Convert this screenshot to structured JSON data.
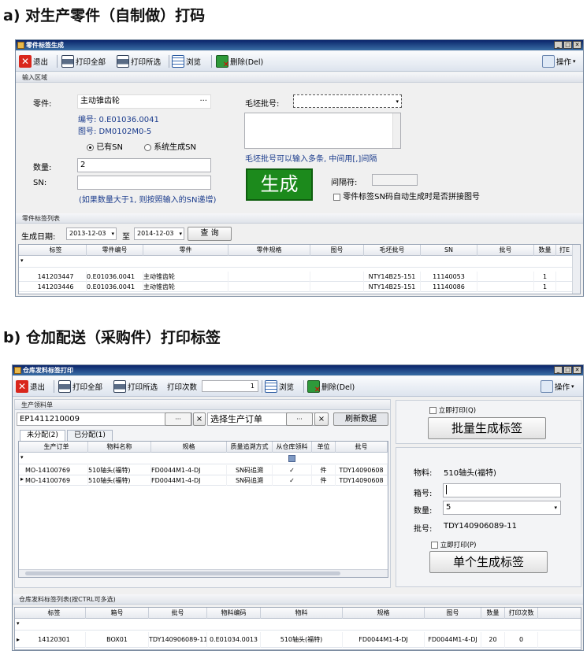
{
  "caption_a": "a) 对生产零件（自制做）打码",
  "caption_b": "b) 仓加配送（采购件）打印标签",
  "win1": {
    "title": "零件标签生成",
    "toolbar": {
      "exit": "退出",
      "print_all": "打印全部",
      "print_selected": "打印所选",
      "browse": "浏览",
      "delete": "删除(Del)",
      "operate": "操作"
    },
    "input_section": "输入区域",
    "part_label": "零件:",
    "part_value": "主动锥齿轮",
    "part_btn": "···",
    "code_line": "编号: 0.E01036.0041",
    "drawing_line": "图号: DM0102M0-5",
    "radio_has_sn": "已有SN",
    "radio_system_sn": "系统生成SN",
    "blank_label": "毛坯批号:",
    "blank_hint": "毛坯批号可以输入多条, 中间用[,]间隔",
    "qty_label": "数量:",
    "qty_value": "2",
    "sn_label": "SN:",
    "sn_hint": "(如果数量大于1, 则按照输入的SN递增)",
    "generate": "生成",
    "separator_label": "间隔符:",
    "concat_check": "零件标签SN码自动生成时是否拼接图号",
    "list_section": "零件标签列表",
    "date_label": "生成日期:",
    "date_from": "2013-12-03",
    "date_to_label": "至",
    "date_to": "2014-12-03",
    "query": "查 询",
    "columns": [
      "标签",
      "零件编号",
      "零件",
      "零件规格",
      "图号",
      "毛坯批号",
      "SN",
      "批号",
      "数量",
      "打E"
    ],
    "rows": [
      [
        "141203447",
        "0.E01036.0041",
        "主动锥齿轮",
        "",
        "",
        "NTY14B25-151",
        "11140053",
        "",
        "1"
      ],
      [
        "141203446",
        "0.E01036.0041",
        "主动锥齿轮",
        "",
        "",
        "NTY14B25-151",
        "11140086",
        "",
        "1"
      ]
    ]
  },
  "win2": {
    "title": "仓库发料标签打印",
    "toolbar": {
      "exit": "退出",
      "print_all": "打印全部",
      "print_selected": "打印所选",
      "print_count_label": "打印次数",
      "print_count": "1",
      "browse": "浏览",
      "delete": "删除(Del)",
      "operate": "操作"
    },
    "order_section": "生产领料单",
    "order_value": "EP1411210009",
    "order_btn": "···",
    "clear_btn": "×",
    "select_order": "选择生产订单",
    "refresh": "刷新数据",
    "tab_unassigned": "未分配(2)",
    "tab_assigned": "已分配(1)",
    "columns": [
      "生产订单",
      "物料名称",
      "规格",
      "质量追溯方式",
      "从仓库领料",
      "单位",
      "批号"
    ],
    "rows": [
      [
        "MO-14100769",
        "510轴头(福特)",
        "FD0044M1-4-DJ",
        "SN码追溯",
        "✓",
        "件",
        "TDY14090608"
      ],
      [
        "MO-14100769",
        "510轴头(福特)",
        "FD0044M1-4-DJ",
        "SN码追溯",
        "✓",
        "件",
        "TDY14090608"
      ]
    ],
    "instant_print_q": "立即打印(Q)",
    "batch_generate": "批量生成标签",
    "material_label": "物料:",
    "material_value": "510轴头(福特)",
    "box_label": "箱号:",
    "qty_label": "数量:",
    "qty_value": "5",
    "batch_label": "批号:",
    "batch_value": "TDY140906089-11",
    "instant_print_p": "立即打印(P)",
    "single_generate": "单个生成标签",
    "list_section": "仓库发料标签列表(按CTRL可多选)",
    "list_columns": [
      "标签",
      "箱号",
      "批号",
      "物料编码",
      "物料",
      "规格",
      "图号",
      "数量",
      "打印次数"
    ],
    "list_rows": [
      [
        "14120301",
        "BOX01",
        "TDY140906089-11",
        "0.E01034.0013",
        "510轴头(福特)",
        "FD0044M1-4-DJ",
        "FD0044M1-4-DJ",
        "20",
        "0"
      ]
    ]
  }
}
